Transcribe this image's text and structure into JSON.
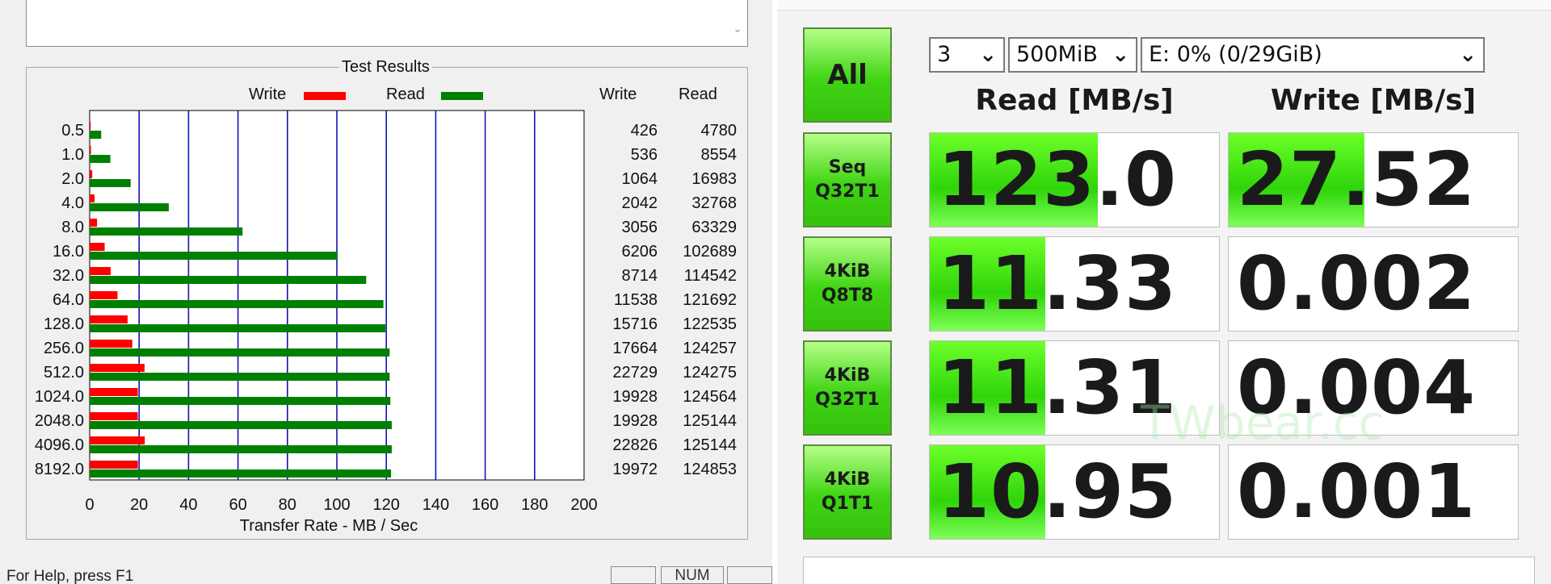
{
  "left": {
    "group_title": "Test Results",
    "legend": {
      "write": "Write",
      "read": "Read"
    },
    "columns": {
      "write": "Write",
      "read": "Read"
    },
    "status": {
      "help_text": "For Help, press F1",
      "num_indicator": "NUM"
    }
  },
  "chart_data": {
    "type": "bar",
    "orientation": "horizontal",
    "title": "Test Results",
    "xlabel": "Transfer Rate - MB / Sec",
    "ylabel": "",
    "xlim": [
      0,
      200
    ],
    "xticks": [
      0,
      20,
      40,
      60,
      80,
      100,
      120,
      140,
      160,
      180,
      200
    ],
    "grid": true,
    "legend_position": "top",
    "categories": [
      "0.5",
      "1.0",
      "2.0",
      "4.0",
      "8.0",
      "16.0",
      "32.0",
      "64.0",
      "128.0",
      "256.0",
      "512.0",
      "1024.0",
      "2048.0",
      "4096.0",
      "8192.0"
    ],
    "series": [
      {
        "name": "Write",
        "color": "#ff0000",
        "values": [
          426,
          536,
          1064,
          2042,
          3056,
          6206,
          8714,
          11538,
          15716,
          17664,
          22729,
          19928,
          19928,
          22826,
          19972
        ]
      },
      {
        "name": "Read",
        "color": "#008000",
        "values": [
          4780,
          8554,
          16983,
          32768,
          63329,
          102689,
          114542,
          121692,
          122535,
          124257,
          124275,
          124564,
          125144,
          125144,
          124853
        ]
      }
    ]
  },
  "right": {
    "all_label": "All",
    "count_select": "3",
    "size_select": "500MiB",
    "drive_select": "E: 0% (0/29GiB)",
    "read_header": "Read [MB/s]",
    "write_header": "Write [MB/s]",
    "watermark": "TWbear.cc",
    "rows": [
      {
        "line1": "Seq",
        "line2": "Q32T1",
        "read": "123.0",
        "write": "27.52",
        "read_fill": 0.58,
        "write_fill": 0.47
      },
      {
        "line1": "4KiB",
        "line2": "Q8T8",
        "read": "11.33",
        "write": "0.002",
        "read_fill": 0.4,
        "write_fill": 0.0
      },
      {
        "line1": "4KiB",
        "line2": "Q32T1",
        "read": "11.31",
        "write": "0.004",
        "read_fill": 0.4,
        "write_fill": 0.0
      },
      {
        "line1": "4KiB",
        "line2": "Q1T1",
        "read": "10.95",
        "write": "0.001",
        "read_fill": 0.4,
        "write_fill": 0.0
      }
    ],
    "colors": {
      "accent_green": "#3fd414"
    }
  }
}
